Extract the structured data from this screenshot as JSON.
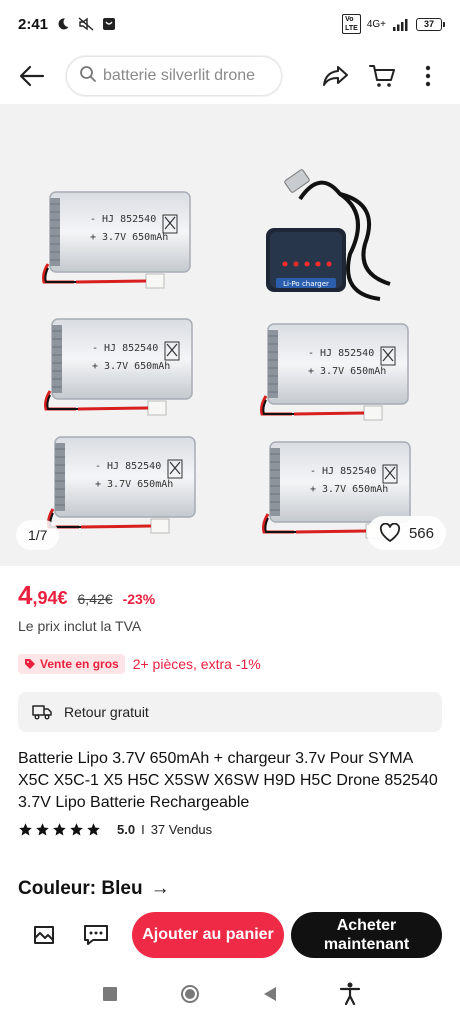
{
  "status_bar": {
    "time": "2:41",
    "network": "4G+",
    "battery": "37"
  },
  "search": {
    "placeholder": "batterie silverlit drone"
  },
  "icons": {
    "back": "back-arrow-icon",
    "search": "search-icon",
    "share": "share-icon",
    "cart": "cart-icon",
    "more": "more-vert-icon",
    "heart": "heart-icon",
    "star": "star-icon",
    "truck": "truck-icon",
    "tag": "tag-icon",
    "store": "store-icon",
    "chat": "chat-icon"
  },
  "gallery": {
    "counter": "1/7",
    "wishlist_count": "566",
    "battery_label_1": "- HJ 852540",
    "battery_label_2": "+ 3.7V 650mAh",
    "charger_label": "Li-Po charger"
  },
  "price": {
    "current_int": "4",
    "current_dec": ",94€",
    "original": "6,42€",
    "discount": "-23%",
    "vat_note": "Le prix inclut la TVA"
  },
  "wholesale": {
    "badge": "Vente en gros",
    "text": "2+ pièces, extra -1%"
  },
  "free_return": {
    "label": "Retour gratuit"
  },
  "product": {
    "title": "Batterie Lipo 3.7V 650mAh + chargeur 3.7v Pour SYMA X5C X5C-1 X5 H5C X5SW X6SW H9D H5C Drone 852540 3.7V Lipo Batterie Rechargeable",
    "rating": "5.0",
    "rating_separator": "I",
    "sold": "37 Vendus",
    "stars": 5
  },
  "variant": {
    "label": "Couleur: Bleu",
    "arrow": "→"
  },
  "actions": {
    "add_to_cart": "Ajouter au panier",
    "buy_now": "Acheter maintenant"
  },
  "colors": {
    "accent_red": "#e9213f",
    "button_red": "#ee2a46",
    "button_black": "#111111",
    "gallery_bg": "#f2f2f2"
  }
}
